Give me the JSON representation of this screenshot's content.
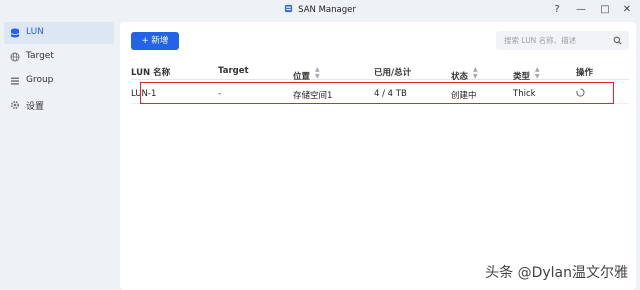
{
  "window": {
    "title": "SAN Manager",
    "help": "?",
    "minimize": "—",
    "maximize": "□",
    "close": "✕"
  },
  "sidebar": {
    "items": [
      {
        "label": "LUN",
        "icon": "database-icon",
        "active": true
      },
      {
        "label": "Target",
        "icon": "globe-icon",
        "active": false
      },
      {
        "label": "Group",
        "icon": "list-icon",
        "active": false
      },
      {
        "label": "设置",
        "icon": "gear-icon",
        "active": false
      }
    ]
  },
  "toolbar": {
    "add_label": "+ 新增",
    "search_placeholder": "搜索 LUN 名称、描述"
  },
  "table": {
    "columns": [
      "LUN 名称",
      "Target",
      "位置",
      "已用/总计",
      "状态",
      "类型",
      "操作"
    ],
    "sortable": [
      false,
      false,
      true,
      false,
      true,
      true,
      false
    ],
    "rows": [
      {
        "name": "LUN-1",
        "target": "-",
        "location": "存储空间1",
        "usage": "4 / 4 TB",
        "status": "创建中",
        "type": "Thick"
      }
    ]
  },
  "colors": {
    "accent": "#2363e6",
    "highlight_border": "#e0272a",
    "sidebar_active_bg": "#dde6f3"
  },
  "watermark": "头条 @Dylan温文尔雅"
}
